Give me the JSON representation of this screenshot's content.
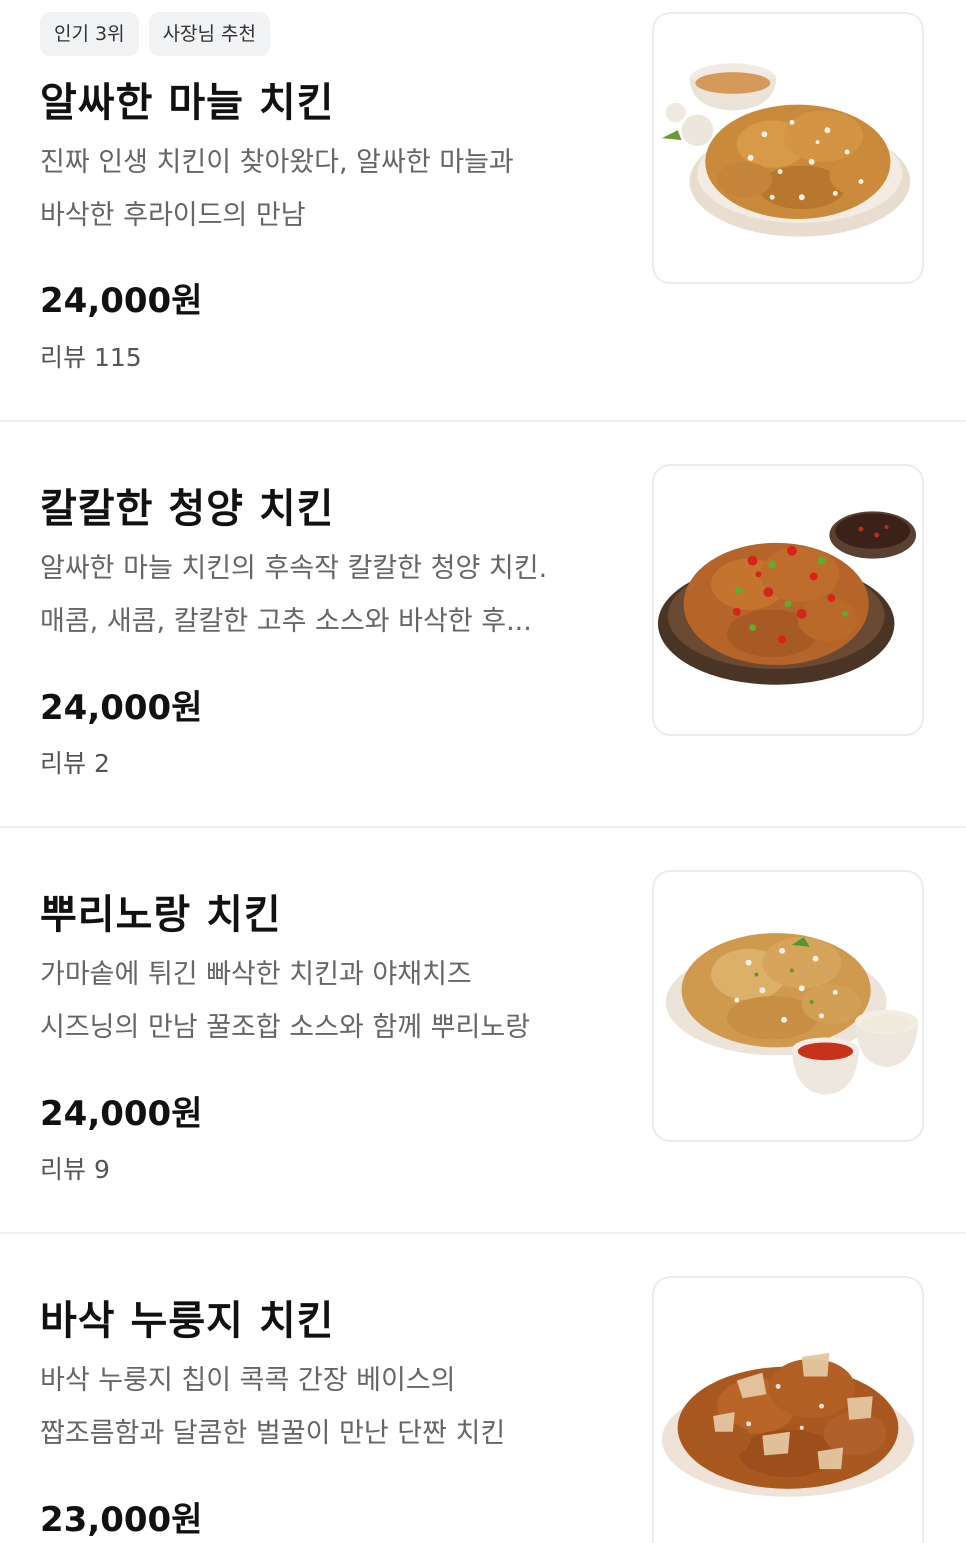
{
  "menu_items": [
    {
      "badges": [
        "인기 3위",
        "사장님 추천"
      ],
      "name": "알싸한 마늘 치킨",
      "desc_line1": "진짜 인생 치킨이 찾아왔다, 알싸한 마늘과",
      "desc_line2": "바삭한 후라이드의 만남",
      "price": "24,000원",
      "reviews": "리뷰 115",
      "image_icon": "garlic-chicken-photo"
    },
    {
      "name": "칼칼한 청양 치킨",
      "desc_line1": "알싸한 마늘 치킨의 후속작 칼칼한 청양 치킨.",
      "desc_line2": "매콤, 새콤, 칼칼한 고추 소스와 바삭한 후...",
      "price": "24,000원",
      "reviews": "리뷰 2",
      "image_icon": "cheongyang-chicken-photo"
    },
    {
      "name": "뿌리노랑 치킨",
      "desc_line1": "가마솥에 튀긴 빠삭한 치킨과 야채치즈",
      "desc_line2": "시즈닝의 만남 꿀조합 소스와 함께 뿌리노랑",
      "price": "24,000원",
      "reviews": "리뷰 9",
      "image_icon": "cheese-seasoned-chicken-photo"
    },
    {
      "name": "바삭 누룽지 치킨",
      "desc_line1": "바삭 누룽지 칩이 콕콕 간장 베이스의",
      "desc_line2": "짭조름함과 달콤한 벌꿀이 만난 단짠 치킨",
      "price": "23,000원",
      "image_icon": "nurungji-chicken-photo"
    }
  ],
  "colors": {
    "text_primary": "#111111",
    "text_secondary": "#666666",
    "badge_bg": "#f2f3f5",
    "divider": "#f0f0f0",
    "thumb_border": "#ececec"
  }
}
